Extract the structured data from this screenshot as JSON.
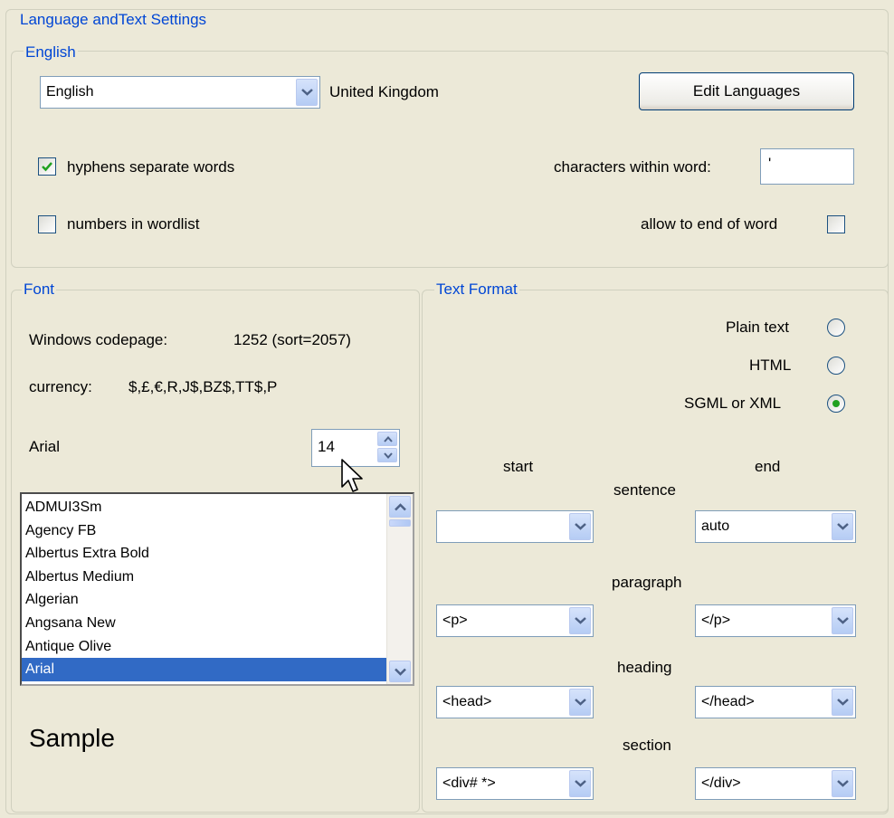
{
  "accent_color": "#0046d5",
  "selection_color": "#316ac5",
  "outer_group": {
    "title": "Language andText Settings"
  },
  "language_group": {
    "title": "English",
    "language_select": {
      "value": "English",
      "icon": "chevron-down-icon"
    },
    "region_label": "United Kingdom",
    "edit_languages_button": "Edit Languages",
    "hyphens_checkbox": {
      "label": "hyphens separate words",
      "checked": true
    },
    "numbers_checkbox": {
      "label": "numbers in wordlist",
      "checked": false
    },
    "characters_within_word": {
      "label": "characters within word:",
      "value": "'"
    },
    "allow_end_of_word": {
      "label": "allow to end of word",
      "checked": false
    }
  },
  "font_group": {
    "title": "Font",
    "codepage_label": "Windows codepage:",
    "codepage_value": "1252 (sort=2057)",
    "currency_label": "currency:",
    "currency_value": "$,£,€,R,J$,BZ$,TT$,P",
    "font_name": "Arial",
    "font_size": "14",
    "font_list": [
      "ADMUI3Sm",
      "Agency FB",
      "Albertus Extra Bold",
      "Albertus Medium",
      "Algerian",
      "Angsana New",
      "Antique Olive",
      "Arial"
    ],
    "selected_font": "Arial",
    "sample_text": "Sample"
  },
  "text_format_group": {
    "title": "Text Format",
    "formats": [
      {
        "label": "Plain text",
        "selected": false
      },
      {
        "label": "HTML",
        "selected": false
      },
      {
        "label": "SGML or XML",
        "selected": true
      }
    ],
    "start_header": "start",
    "end_header": "end",
    "rows": [
      {
        "label": "sentence",
        "start": "",
        "end": "auto"
      },
      {
        "label": "paragraph",
        "start": "<p>",
        "end": "</p>"
      },
      {
        "label": "heading",
        "start": "<head>",
        "end": "</head>"
      },
      {
        "label": "section",
        "start": "<div# *>",
        "end": "</div>"
      }
    ]
  }
}
